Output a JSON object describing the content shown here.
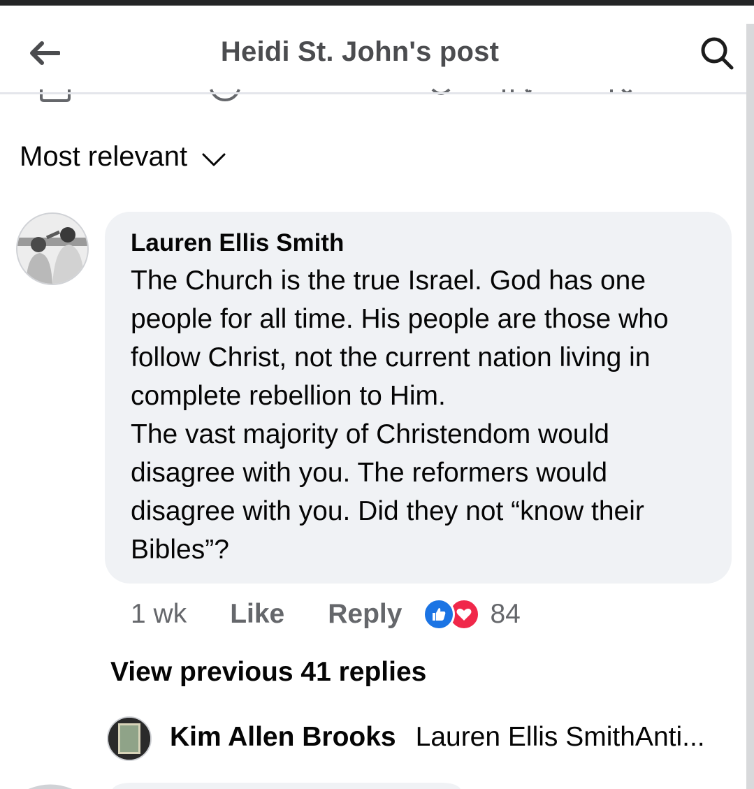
{
  "header": {
    "title": "Heidi St. John's post",
    "back_icon": "arrow-left-icon",
    "search_icon": "search-icon"
  },
  "sort": {
    "label": "Most relevant",
    "icon": "chevron-down-icon"
  },
  "comment": {
    "author": "Lauren Ellis Smith",
    "lines": [
      "The Church is the true Israel. God has one",
      "people for all time. His people are those who",
      "follow Christ, not the current nation living in",
      "complete rebellion to Him.",
      "The vast majority of Christendom would",
      "disagree with you. The reformers would",
      "disagree with you. Did they not “know their",
      "Bibles”?"
    ],
    "time": "1 wk",
    "like_label": "Like",
    "reply_label": "Reply",
    "reaction_count": "84",
    "reaction_icons": [
      "like-reaction-icon",
      "love-reaction-icon"
    ]
  },
  "replies": {
    "view_previous": "View previous 41 replies",
    "latest": {
      "author": "Kim Allen Brooks",
      "text": "Lauren Ellis SmithAnti..."
    }
  },
  "colors": {
    "bubble": "#f0f2f5",
    "secondary_text": "#65676b",
    "like_blue": "#1b74e4",
    "love_red": "#f0284a"
  }
}
